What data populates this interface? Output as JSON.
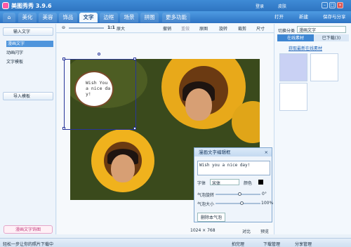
{
  "app": {
    "title": "美图秀秀 3.9.6",
    "login": "登录",
    "skin": "皮肤"
  },
  "menu": {
    "tabs": [
      "美化",
      "美容",
      "饰品",
      "文字",
      "边框",
      "场景",
      "拼图"
    ],
    "more": "更多功能",
    "open": "打开",
    "new": "新建",
    "save": "保存与分享"
  },
  "toolbar": {
    "zoom_ratio": "1:1",
    "fit": "原大",
    "tools": [
      "撤销",
      "重做",
      "原图",
      "旋转",
      "裁剪",
      "尺寸"
    ]
  },
  "left": {
    "input_text": "输入文字",
    "items": [
      "漫画文字",
      "动画闪字",
      "文字模板"
    ],
    "import": "导入模板",
    "diy": "漫画文字饰图"
  },
  "bubble": {
    "text_line1": "Wish You",
    "text_line2": "a nice da",
    "text_line3": "y!"
  },
  "dialog": {
    "title": "漫画文字编辑框",
    "text": "Wish you a nice day!",
    "font_label": "字体",
    "font_value": "宋体",
    "color_label": "颜色",
    "rotate_label": "气泡旋转",
    "rotate_value": "0°",
    "size_label": "气泡大小",
    "size_value": "100%",
    "delete": "删除本气泡",
    "rotate_frac": 0.5,
    "size_frac": 0.55
  },
  "canvas": {
    "dims": "1024 × 768",
    "compare": "对比",
    "preview": "预览"
  },
  "right": {
    "category_label": "切换分类",
    "category_value": "漫画文字",
    "tab_online": "在线素材",
    "tab_downloaded": "已下载(3)",
    "link": "获取最新在线素材"
  },
  "status": {
    "tip": "轻松一步让你的照片下载中",
    "favorites": "拍完理",
    "downloads": "下载管理",
    "share": "分享管理"
  }
}
